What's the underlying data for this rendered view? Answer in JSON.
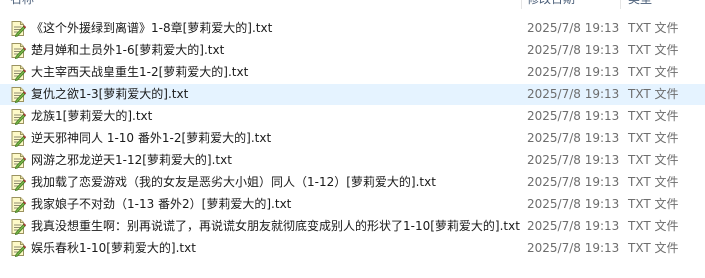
{
  "columns": {
    "name": "名称",
    "date": "修改日期",
    "type": "类型"
  },
  "files": [
    {
      "name": "《这个外援绿到离谱》1-8章[萝莉爱大的].txt",
      "date": "2025/7/8 19:13",
      "type": "TXT 文件"
    },
    {
      "name": "楚月婵和土员外1-6[萝莉爱大的].txt",
      "date": "2025/7/8 19:13",
      "type": "TXT 文件"
    },
    {
      "name": "大主宰西天战皇重生1-2[萝莉爱大的].txt",
      "date": "2025/7/8 19:13",
      "type": "TXT 文件"
    },
    {
      "name": "复仇之欲1-3[萝莉爱大的].txt",
      "date": "2025/7/8 19:13",
      "type": "TXT 文件"
    },
    {
      "name": "龙族1[萝莉爱大的].txt",
      "date": "2025/7/8 19:13",
      "type": "TXT 文件"
    },
    {
      "name": "逆天邪神同人 1-10 番外1-2[萝莉爱大的].txt",
      "date": "2025/7/8 19:13",
      "type": "TXT 文件"
    },
    {
      "name": "网游之邪龙逆天1-12[萝莉爱大的].txt",
      "date": "2025/7/8 19:13",
      "type": "TXT 文件"
    },
    {
      "name": "我加载了恋爱游戏（我的女友是恶劣大小姐）同人（1-12）[萝莉爱大的].txt",
      "date": "2025/7/8 19:13",
      "type": "TXT 文件"
    },
    {
      "name": "我家娘子不对劲（1-13 番外2）[萝莉爱大的].txt",
      "date": "2025/7/8 19:13",
      "type": "TXT 文件"
    },
    {
      "name": "我真没想重生啊：别再说谎了，再说谎女朋友就彻底变成别人的形状了1-10[萝莉爱大的].txt",
      "date": "2025/7/8 19:13",
      "type": "TXT 文件"
    },
    {
      "name": "娱乐春秋1-10[萝莉爱大的].txt",
      "date": "2025/7/8 19:13",
      "type": "TXT 文件"
    }
  ],
  "hovered_row": 3,
  "colors": {
    "hover_bg": "#e5f3ff",
    "name_text": "#1a1a1a",
    "meta_text": "#6d6d6d",
    "header_text": "#4c607a"
  },
  "icons": {
    "file": "text-file-icon"
  }
}
